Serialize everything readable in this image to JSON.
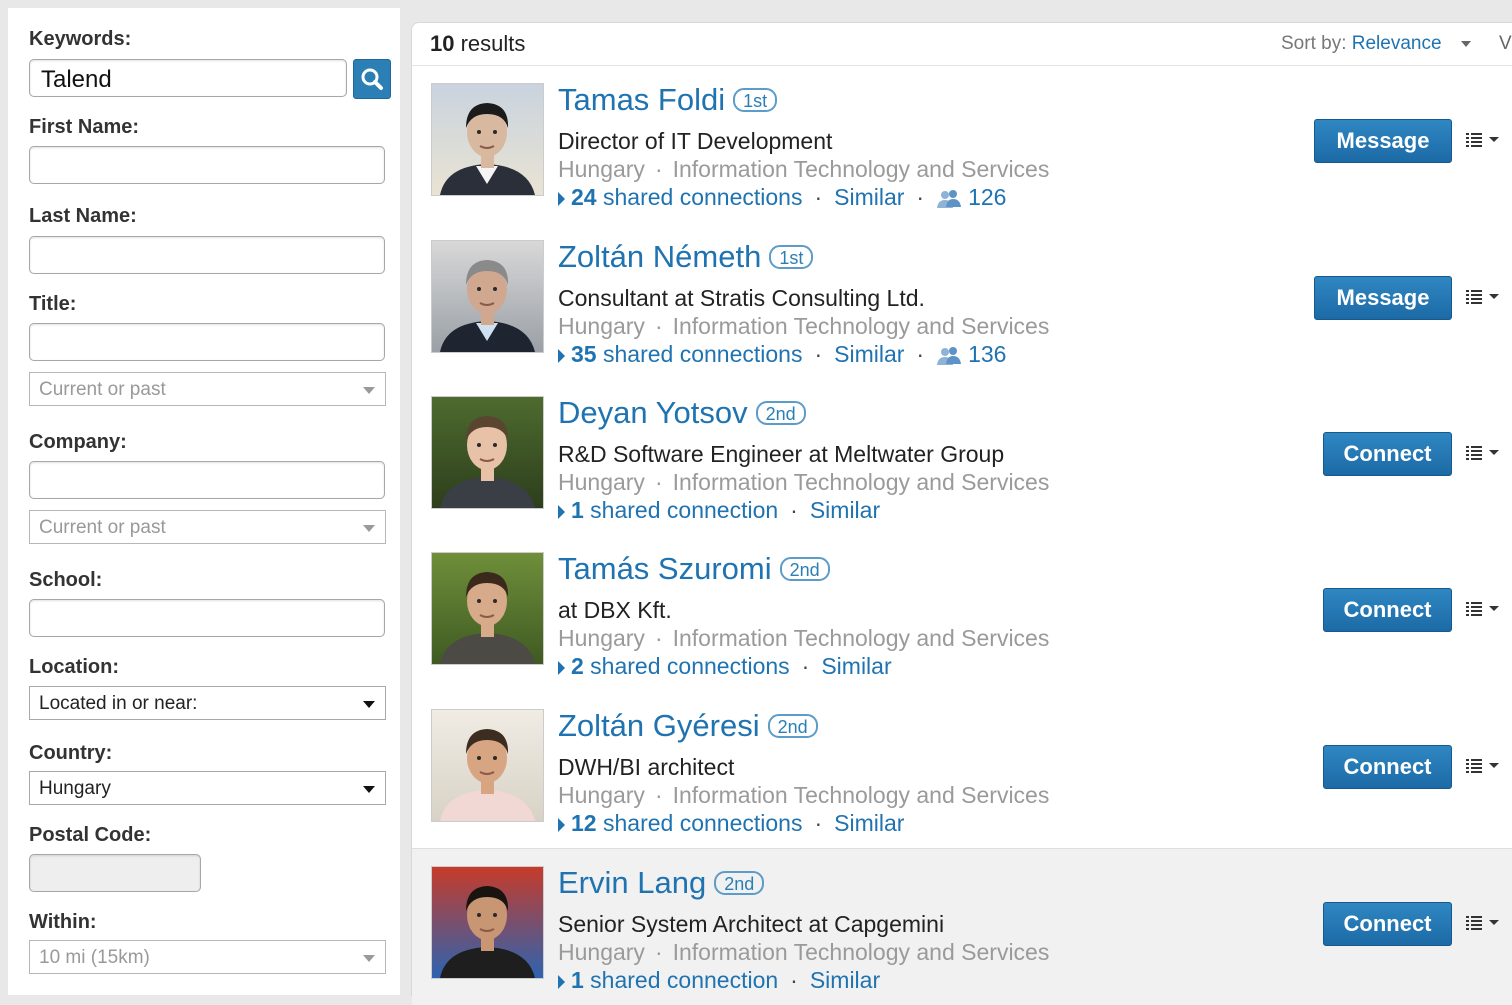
{
  "filters": {
    "keywords_label": "Keywords:",
    "keywords_value": "Talend",
    "first_name_label": "First Name:",
    "last_name_label": "Last Name:",
    "title_label": "Title:",
    "title_scope": "Current or past",
    "company_label": "Company:",
    "company_scope": "Current or past",
    "school_label": "School:",
    "location_label": "Location:",
    "location_value": "Located in or near:",
    "country_label": "Country:",
    "country_value": "Hungary",
    "postal_label": "Postal Code:",
    "within_label": "Within:",
    "within_value": "10 mi (15km)"
  },
  "results": {
    "count": "10",
    "count_suffix": " results",
    "sort_label": "Sort by: ",
    "sort_value": "Relevance",
    "view_label": "V",
    "people": [
      {
        "name": "Tamas Foldi",
        "degree": "1st",
        "headline": "Director of IT Development",
        "location": "Hungary",
        "industry": "Information Technology and Services",
        "shared_count": "24",
        "shared_text": " shared connections",
        "similar": "Similar",
        "group_count": "126",
        "action": "Message"
      },
      {
        "name": "Zoltán Németh",
        "degree": "1st",
        "headline": "Consultant at Stratis Consulting Ltd.",
        "location": "Hungary",
        "industry": "Information Technology and Services",
        "shared_count": "35",
        "shared_text": " shared connections",
        "similar": "Similar",
        "group_count": "136",
        "action": "Message"
      },
      {
        "name": "Deyan Yotsov",
        "degree": "2nd",
        "headline": "R&D Software Engineer at Meltwater Group",
        "location": "Hungary",
        "industry": "Information Technology and Services",
        "shared_count": "1",
        "shared_text": " shared connection",
        "similar": "Similar",
        "action": "Connect"
      },
      {
        "name": "Tamás Szuromi",
        "degree": "2nd",
        "headline": "at DBX Kft.",
        "location": "Hungary",
        "industry": "Information Technology and Services",
        "shared_count": "2",
        "shared_text": " shared connections",
        "similar": "Similar",
        "action": "Connect"
      },
      {
        "name": "Zoltán Gyéresi",
        "degree": "2nd",
        "headline": "DWH/BI architect",
        "location": "Hungary",
        "industry": "Information Technology and Services",
        "shared_count": "12",
        "shared_text": " shared connections",
        "similar": "Similar",
        "action": "Connect"
      },
      {
        "name": "Ervin Lang",
        "degree": "2nd",
        "headline": "Senior System Architect at Capgemini",
        "location": "Hungary",
        "industry": "Information Technology and Services",
        "shared_count": "1",
        "shared_text": " shared connection",
        "similar": "Similar",
        "action": "Connect"
      }
    ]
  },
  "icons": {
    "search": "search-icon",
    "groups": "group-icon",
    "more": "list-menu-icon"
  },
  "colors": {
    "link": "#1f73b1",
    "button": "#2b7fb5",
    "muted": "#9a9a9a"
  }
}
